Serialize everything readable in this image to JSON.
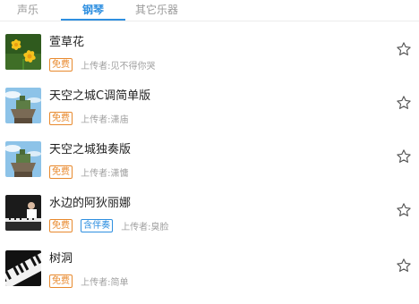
{
  "tabs": [
    {
      "label": "声乐"
    },
    {
      "label": "钢琴"
    },
    {
      "label": "其它乐器"
    }
  ],
  "songs": [
    {
      "title": "萱草花",
      "badges": [
        "免费"
      ],
      "uploader": "上传者:见不得你哭",
      "thumb": "yellow-flowers"
    },
    {
      "title": "天空之城C调简单版",
      "badges": [
        "免费"
      ],
      "uploader": "上传者:潇庙",
      "thumb": "castle-in-sky"
    },
    {
      "title": "天空之城独奏版",
      "badges": [
        "免费"
      ],
      "uploader": "上传者:潇慵",
      "thumb": "castle-in-sky"
    },
    {
      "title": "水边的阿狄丽娜",
      "badges": [
        "免费",
        "含伴奏"
      ],
      "uploader": "上传者:臭脸",
      "thumb": "pianist"
    },
    {
      "title": "树洞",
      "badges": [
        "免费"
      ],
      "uploader": "上传者:简单",
      "thumb": "piano-keys"
    }
  ],
  "colors": {
    "accent": "#2e8fe0",
    "free_badge": "#e8892d",
    "accompaniment_badge": "#2e8fe0"
  },
  "icons": {
    "favorite": "star-outline-icon"
  }
}
